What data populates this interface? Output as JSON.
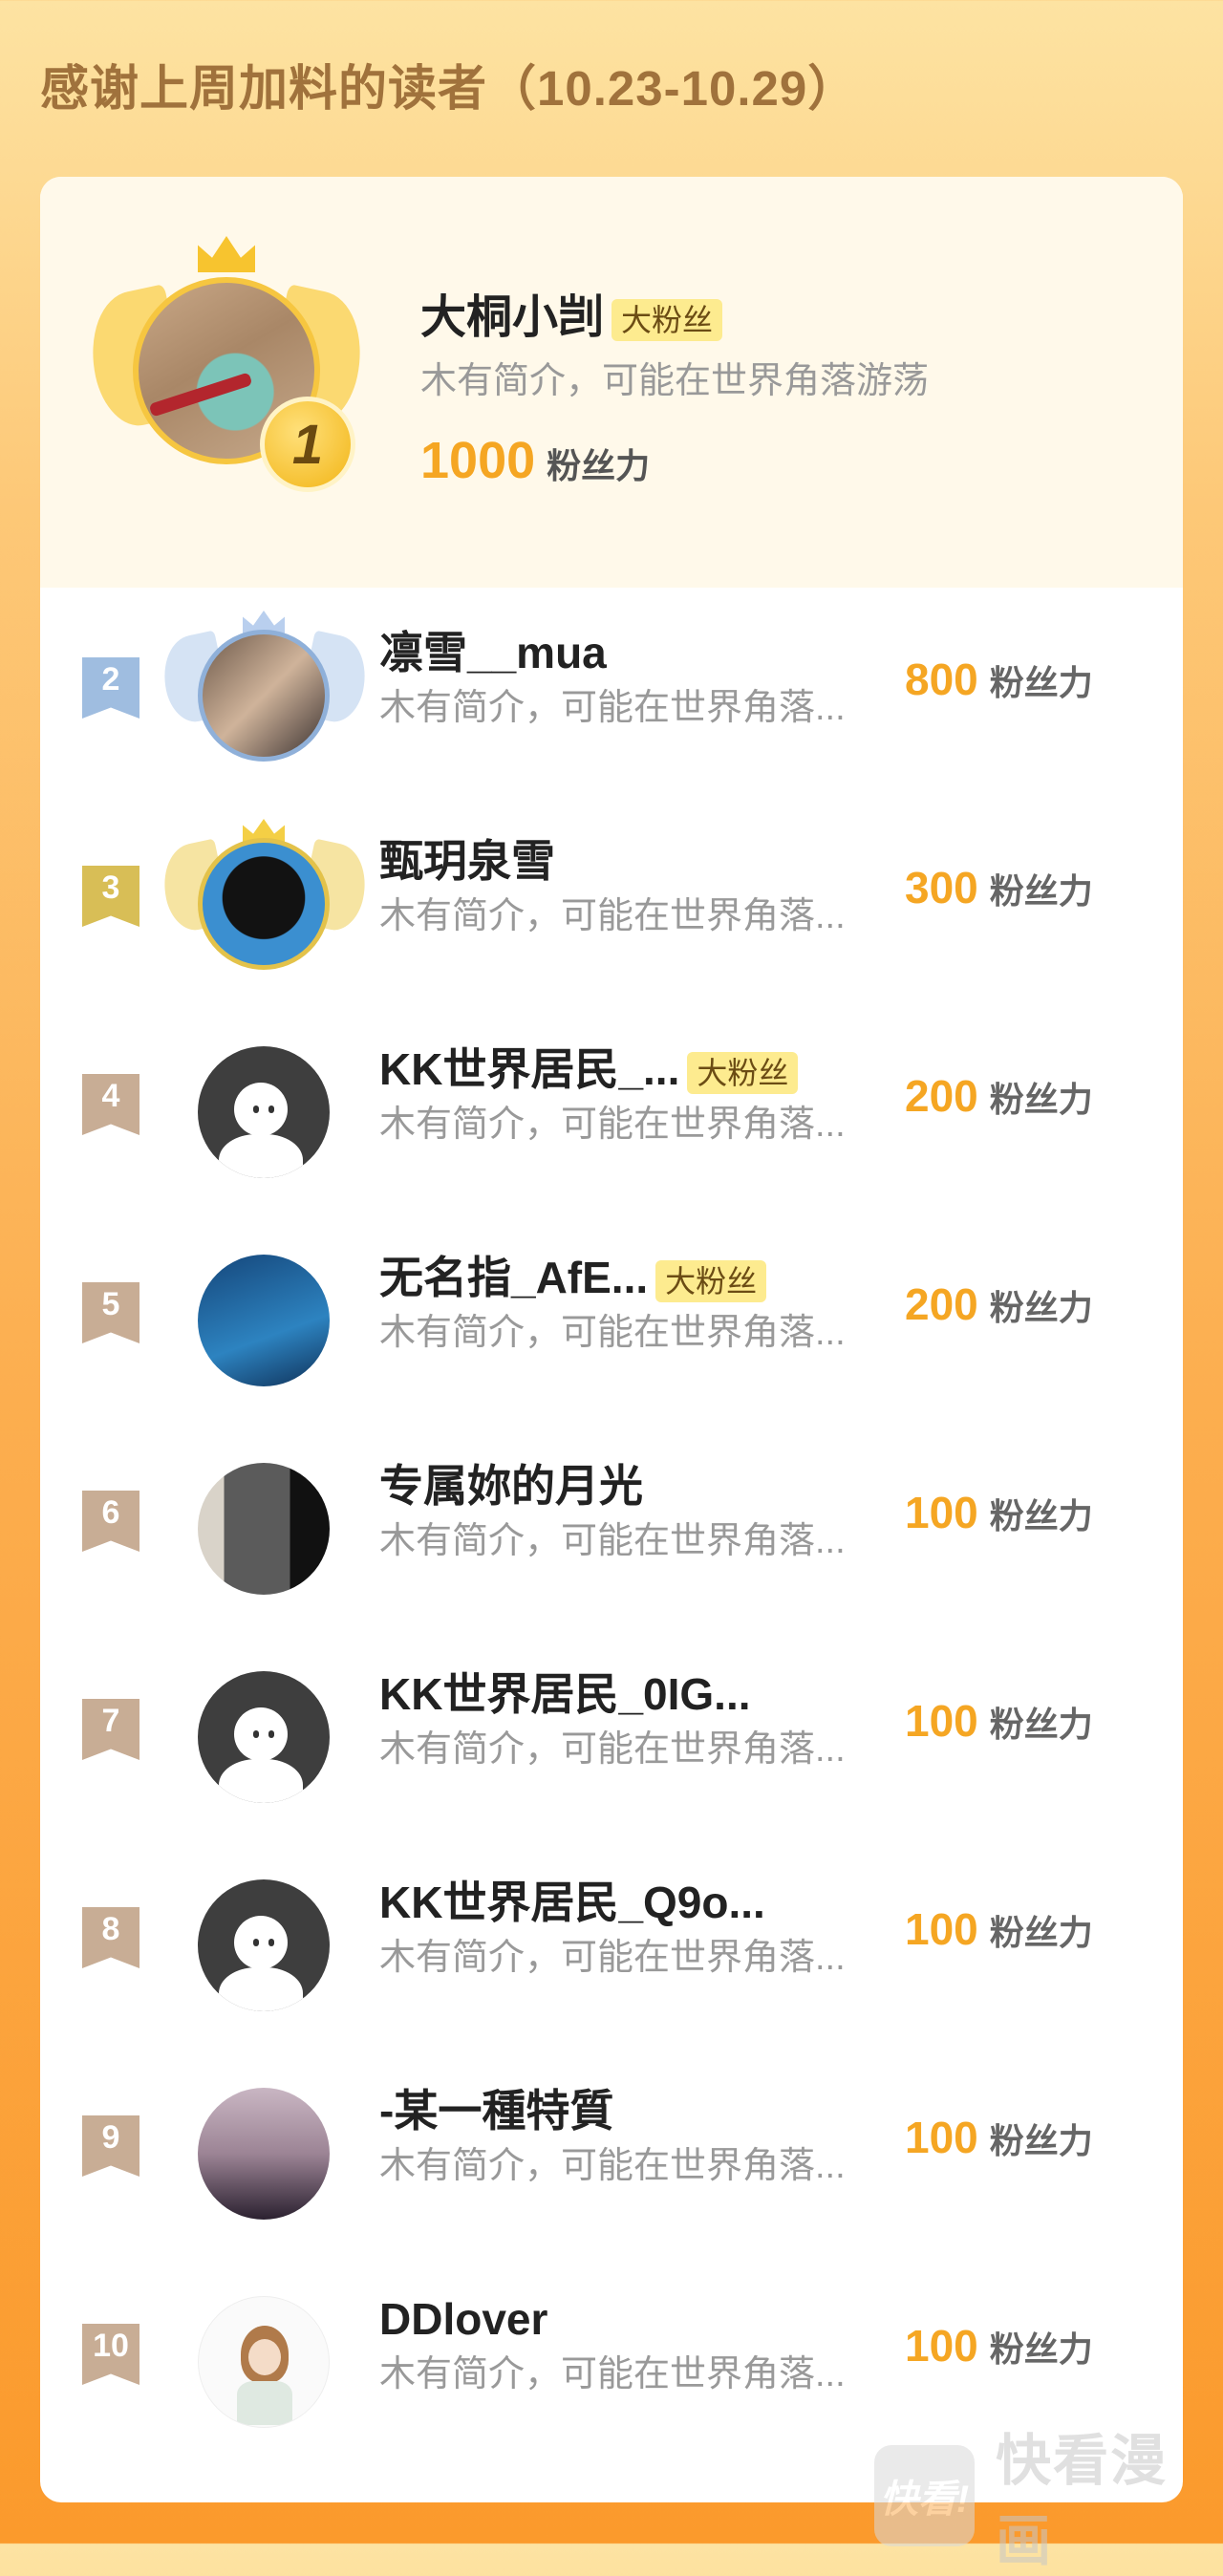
{
  "page": {
    "title": "感谢上周加料的读者（10.23-10.29）"
  },
  "unit_label": "粉丝力",
  "badge_label": "大粉丝",
  "top_reader": {
    "rank": "1",
    "name": "大桐小剀",
    "badge": "大粉丝",
    "bio": "木有简介，可能在世界角落游荡",
    "power": "1000",
    "power_unit": "粉丝力"
  },
  "readers": [
    {
      "rank": "2",
      "name": "凛雪__mua",
      "badge": "",
      "bio": "木有简介，可能在世界角落...",
      "power": "800",
      "power_unit": "粉丝力"
    },
    {
      "rank": "3",
      "name": "甄玥泉雪",
      "badge": "",
      "bio": "木有简介，可能在世界角落...",
      "power": "300",
      "power_unit": "粉丝力"
    },
    {
      "rank": "4",
      "name": "KK世界居民_...",
      "badge": "大粉丝",
      "bio": "木有简介，可能在世界角落...",
      "power": "200",
      "power_unit": "粉丝力"
    },
    {
      "rank": "5",
      "name": "无名指_AfE...",
      "badge": "大粉丝",
      "bio": "木有简介，可能在世界角落...",
      "power": "200",
      "power_unit": "粉丝力"
    },
    {
      "rank": "6",
      "name": "专属妳的月光",
      "badge": "",
      "bio": "木有简介，可能在世界角落...",
      "power": "100",
      "power_unit": "粉丝力"
    },
    {
      "rank": "7",
      "name": "KK世界居民_0IG...",
      "badge": "",
      "bio": "木有简介，可能在世界角落...",
      "power": "100",
      "power_unit": "粉丝力"
    },
    {
      "rank": "8",
      "name": "KK世界居民_Q9o...",
      "badge": "",
      "bio": "木有简介，可能在世界角落...",
      "power": "100",
      "power_unit": "粉丝力"
    },
    {
      "rank": "9",
      "name": "-某一種特質",
      "badge": "",
      "bio": "木有简介，可能在世界角落...",
      "power": "100",
      "power_unit": "粉丝力"
    },
    {
      "rank": "10",
      "name": "DDlover",
      "badge": "",
      "bio": "木有简介，可能在世界角落...",
      "power": "100",
      "power_unit": "粉丝力"
    }
  ],
  "watermark": {
    "logo": "快看!",
    "text": "快看漫画"
  },
  "colors": {
    "accent": "#f5a623",
    "title": "#a0723c",
    "badge_bg": "#fdeb8f"
  }
}
